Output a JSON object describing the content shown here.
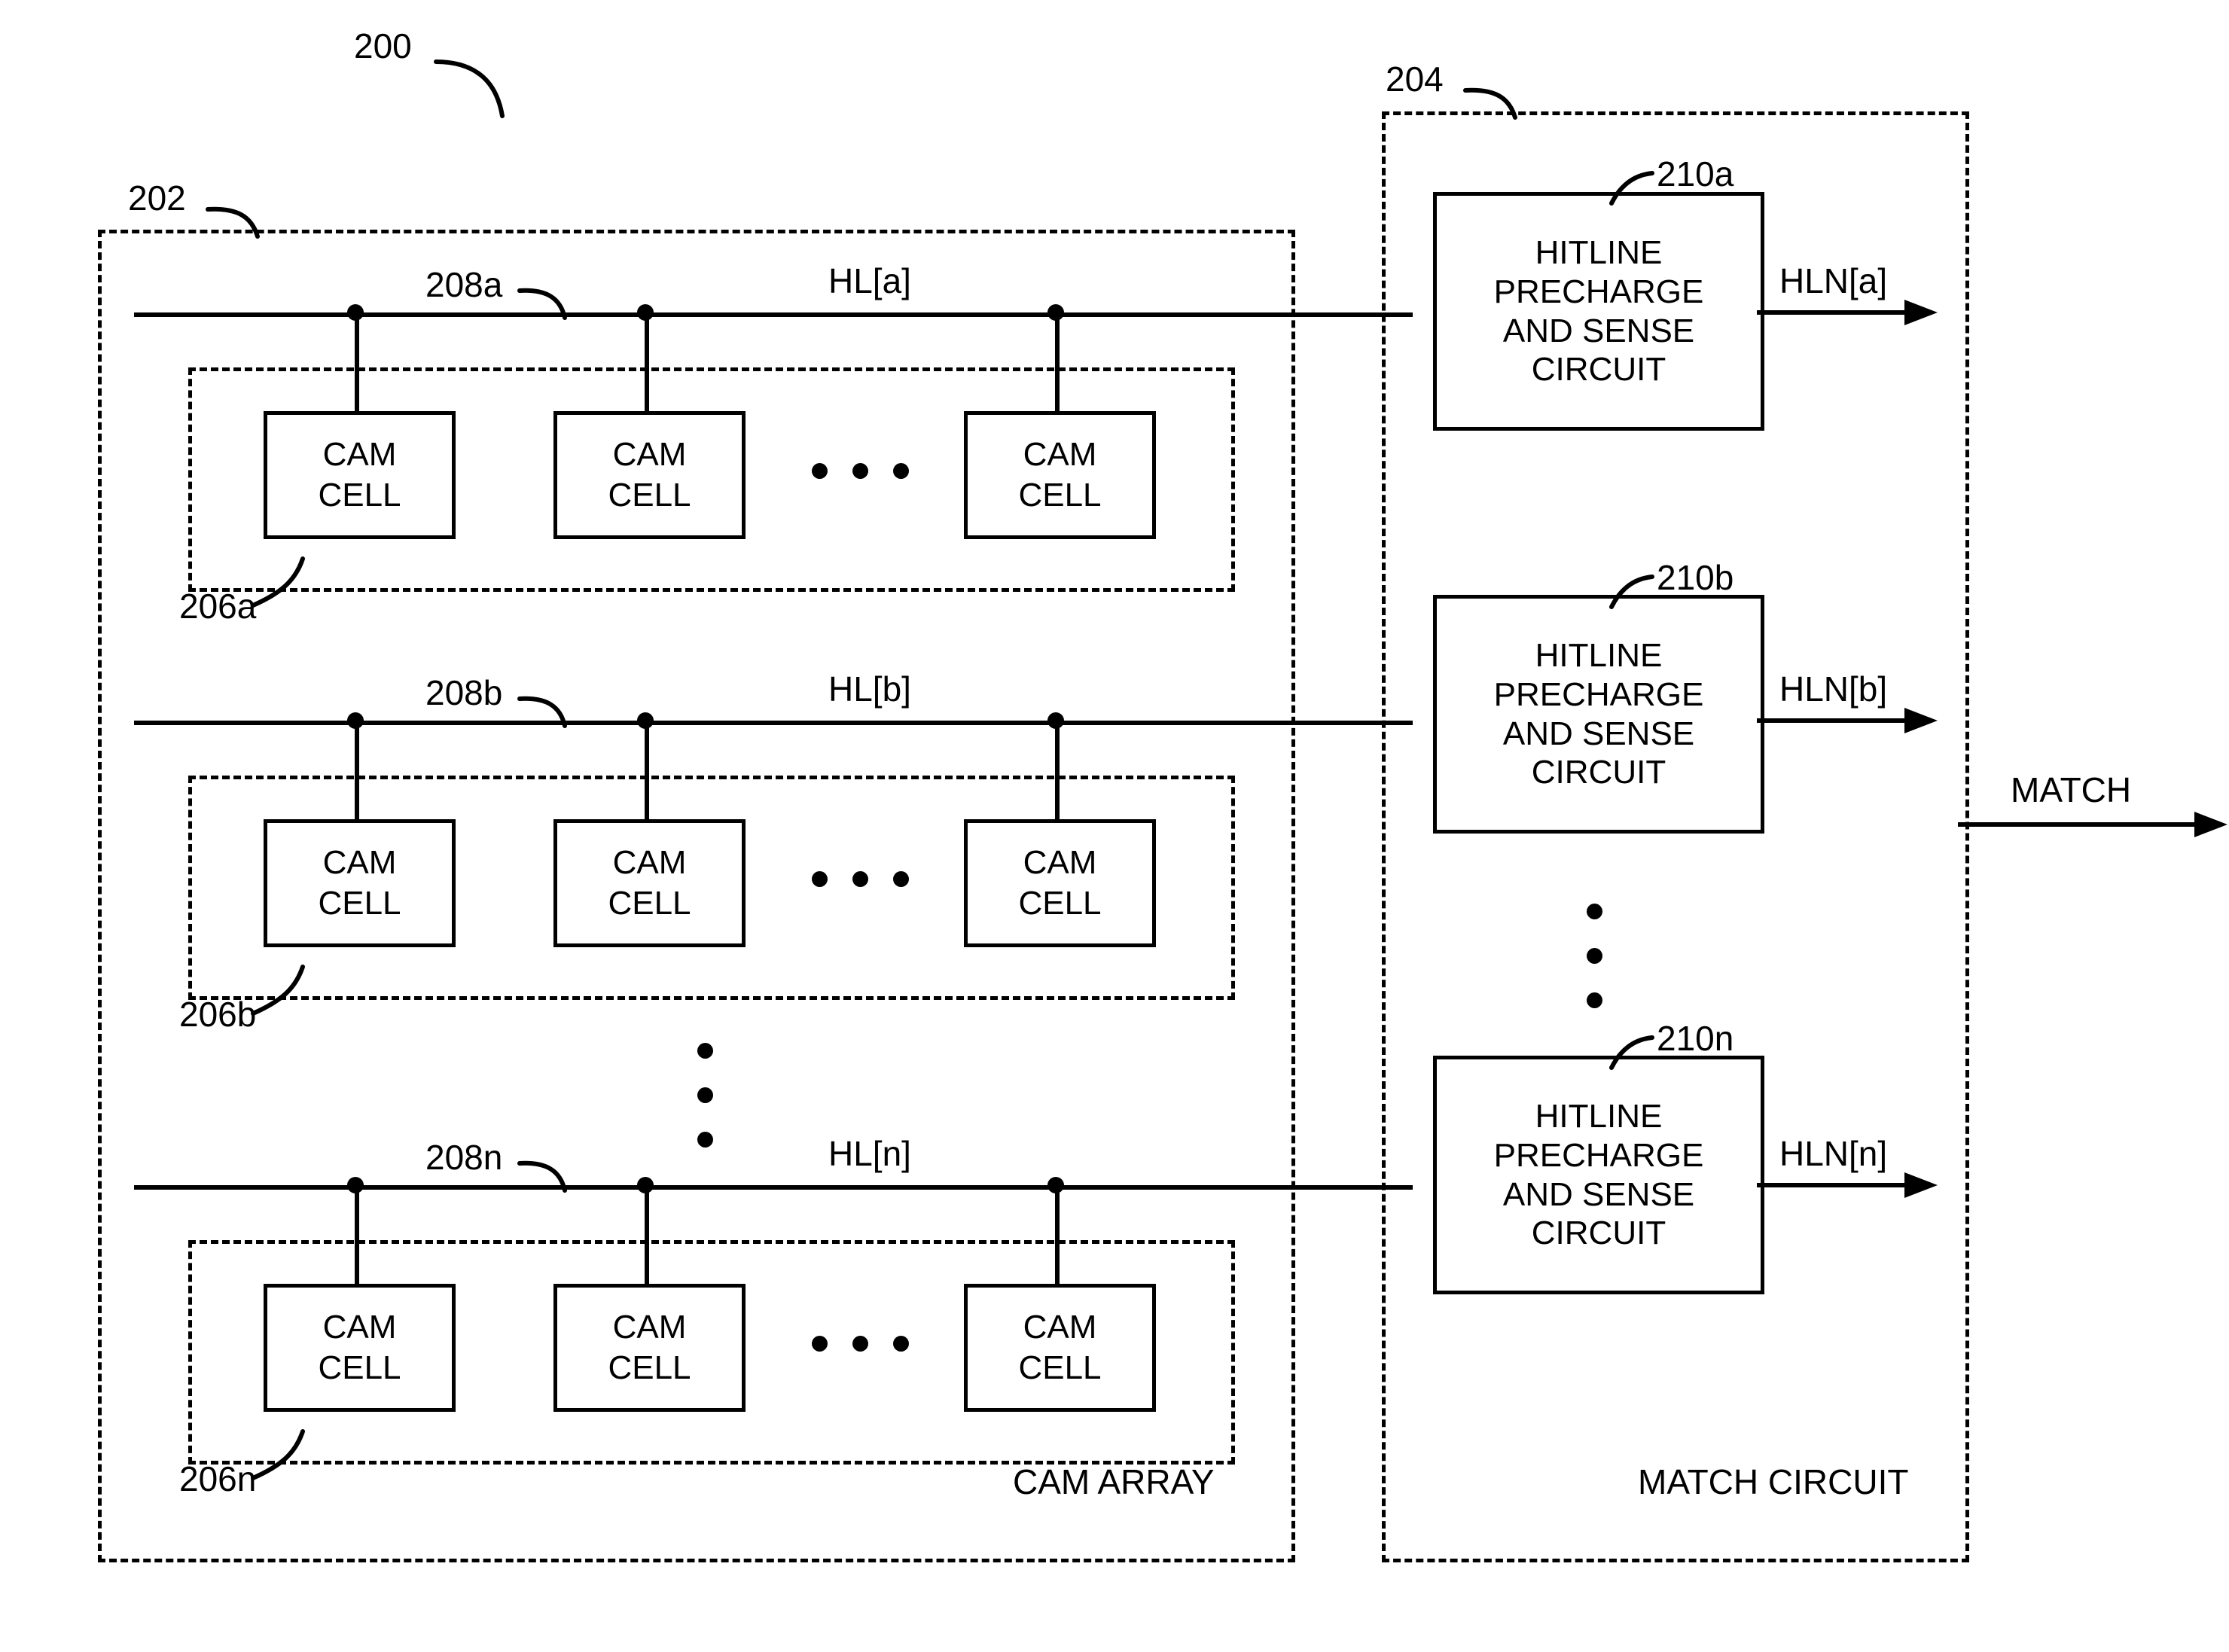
{
  "figure": {
    "top_reference": "200",
    "cam_array_reference": "202",
    "match_circuit_reference": "204",
    "cam_array_label": "CAM ARRAY",
    "match_circuit_label": "MATCH CIRCUIT",
    "match_output_label": "MATCH"
  },
  "rows": [
    {
      "row_reference": "206a",
      "hitline_reference": "208a",
      "hitline_label": "HL[a]",
      "precharge_reference": "210a",
      "precharge_label": "HITLINE PRECHARGE AND SENSE CIRCUIT",
      "precharge_lines": [
        "HITLINE",
        "PRECHARGE",
        "AND SENSE",
        "CIRCUIT"
      ],
      "output_label": "HLN[a]",
      "cells": [
        {
          "line1": "CAM",
          "line2": "CELL"
        },
        {
          "line1": "CAM",
          "line2": "CELL"
        },
        {
          "line1": "CAM",
          "line2": "CELL"
        }
      ],
      "cells_ellipsis": "• • •"
    },
    {
      "row_reference": "206b",
      "hitline_reference": "208b",
      "hitline_label": "HL[b]",
      "precharge_reference": "210b",
      "precharge_label": "HITLINE PRECHARGE AND SENSE CIRCUIT",
      "precharge_lines": [
        "HITLINE",
        "PRECHARGE",
        "AND SENSE",
        "CIRCUIT"
      ],
      "output_label": "HLN[b]",
      "cells": [
        {
          "line1": "CAM",
          "line2": "CELL"
        },
        {
          "line1": "CAM",
          "line2": "CELL"
        },
        {
          "line1": "CAM",
          "line2": "CELL"
        }
      ],
      "cells_ellipsis": "• • •"
    },
    {
      "row_reference": "206n",
      "hitline_reference": "208n",
      "hitline_label": "HL[n]",
      "precharge_reference": "210n",
      "precharge_label": "HITLINE PRECHARGE AND SENSE CIRCUIT",
      "precharge_lines": [
        "HITLINE",
        "PRECHARGE",
        "AND SENSE",
        "CIRCUIT"
      ],
      "output_label": "HLN[n]",
      "cells": [
        {
          "line1": "CAM",
          "line2": "CELL"
        },
        {
          "line1": "CAM",
          "line2": "CELL"
        },
        {
          "line1": "CAM",
          "line2": "CELL"
        }
      ],
      "cells_ellipsis": "• • •"
    }
  ],
  "colors": {
    "ink": "#000000",
    "paper": "#ffffff"
  }
}
